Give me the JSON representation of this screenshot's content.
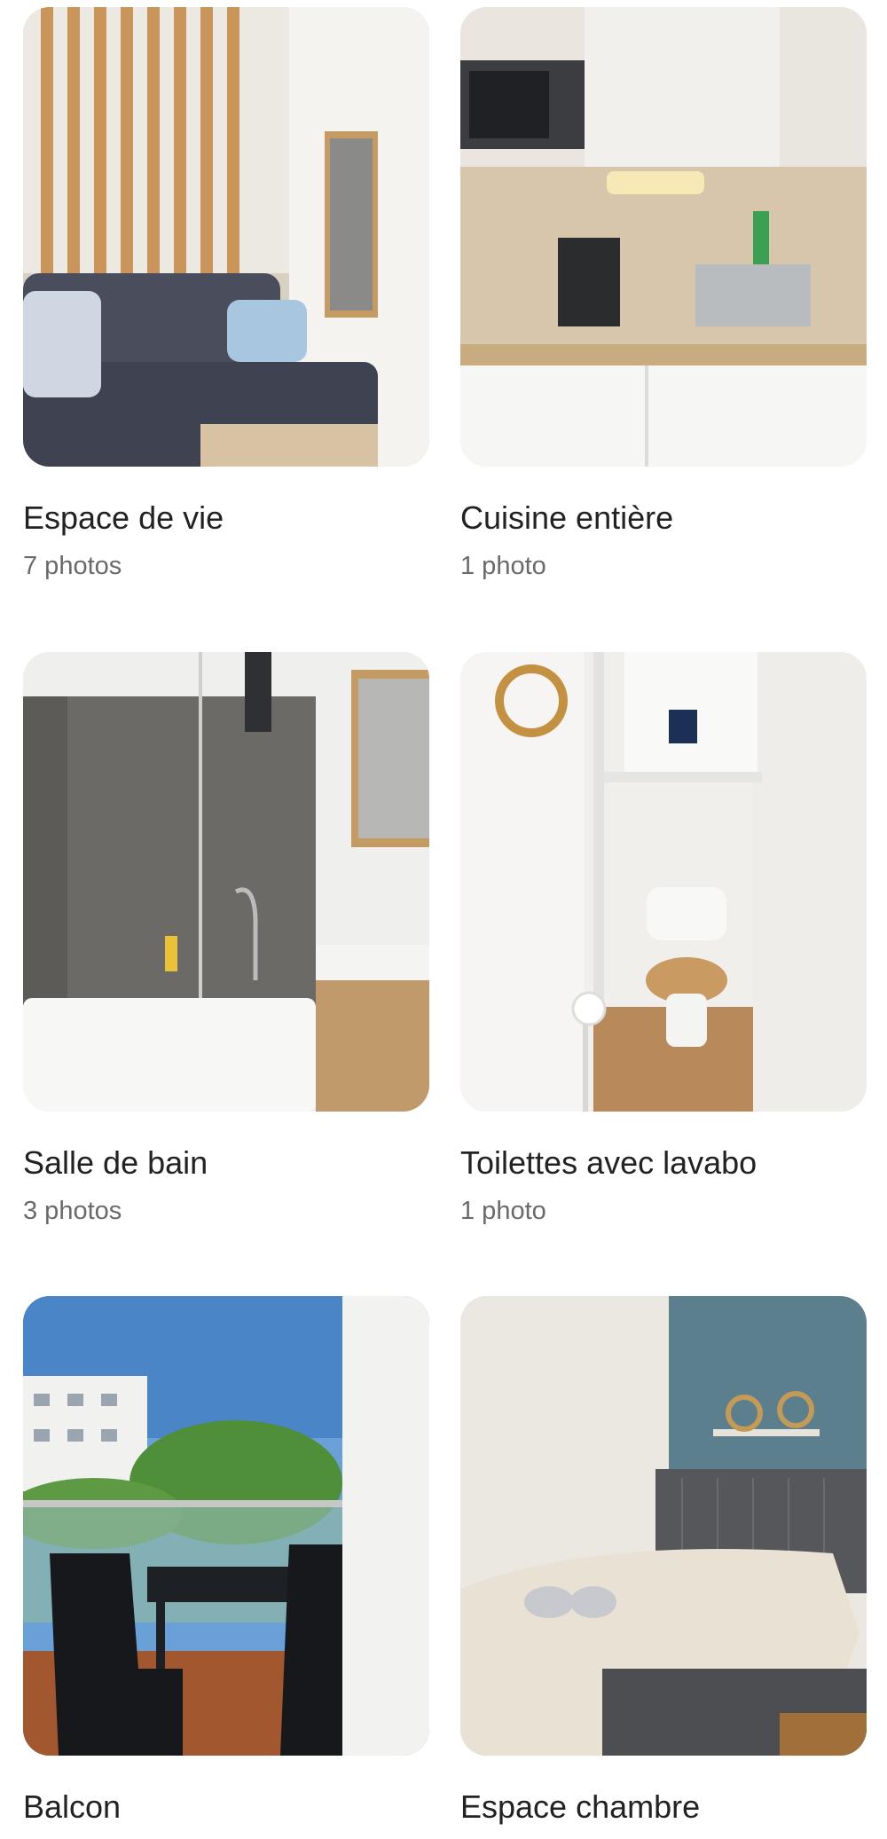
{
  "rooms": [
    {
      "title": "Espace de vie",
      "count": "7 photos"
    },
    {
      "title": "Cuisine entière",
      "count": "1 photo"
    },
    {
      "title": "Salle de bain",
      "count": "3 photos"
    },
    {
      "title": "Toilettes avec lavabo",
      "count": "1 photo"
    },
    {
      "title": "Balcon",
      "count": ""
    },
    {
      "title": "Espace chambre",
      "count": ""
    }
  ]
}
